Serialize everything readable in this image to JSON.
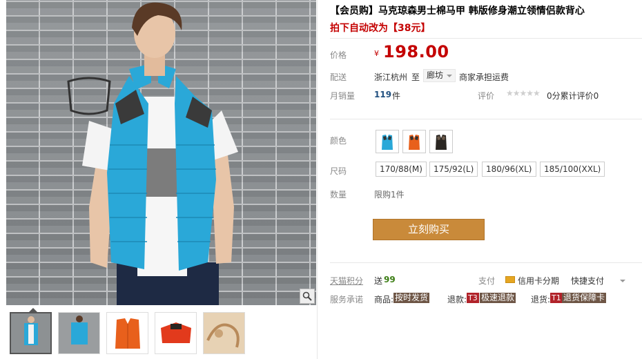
{
  "product": {
    "title": "【会员购】马克琼森男士棉马甲 韩版修身潮立领情侣款背心",
    "promo": "拍下自动改为【38元】"
  },
  "price": {
    "label": "价格",
    "symbol": "¥",
    "value": "198.00"
  },
  "shipping": {
    "label": "配送",
    "origin": "浙江杭州",
    "to": "至",
    "destination": "廊坊",
    "fee_note": "商家承担运费"
  },
  "sales": {
    "label": "月销量",
    "count": "119",
    "unit": "件",
    "rating_label": "评价",
    "stars": "★★★★★",
    "rating_text": "0分累计评价0"
  },
  "color": {
    "label": "颜色",
    "options": [
      {
        "name": "blue-vest",
        "hex": "#2aa8d8"
      },
      {
        "name": "orange-vest",
        "hex": "#e8601c"
      },
      {
        "name": "black-vest",
        "hex": "#2a2622"
      }
    ]
  },
  "size": {
    "label": "尺码",
    "options": [
      "170/88(M)",
      "175/92(L)",
      "180/96(XL)",
      "185/100(XXL)"
    ]
  },
  "quantity": {
    "label": "数量",
    "limit": "限购1件"
  },
  "buy_button": "立刻购买",
  "points": {
    "label": "天猫积分",
    "prefix": "送",
    "value": "99"
  },
  "payment": {
    "label": "支付",
    "credit": "信用卡分期",
    "quick": "快捷支付"
  },
  "service": {
    "label": "服务承诺",
    "goods_label": "商品:",
    "goods_tag": "按时发货",
    "refund_label": "退款:",
    "refund_code": "T3",
    "refund_tag": "极速退款",
    "return_label": "退货:",
    "return_code": "T1",
    "return_tag": "退货保障卡"
  },
  "colors": {
    "price_red": "#c40000",
    "buy_button": "#c98a3a",
    "vest_blue": "#2aa8d8",
    "points_green": "#3b7d13"
  }
}
